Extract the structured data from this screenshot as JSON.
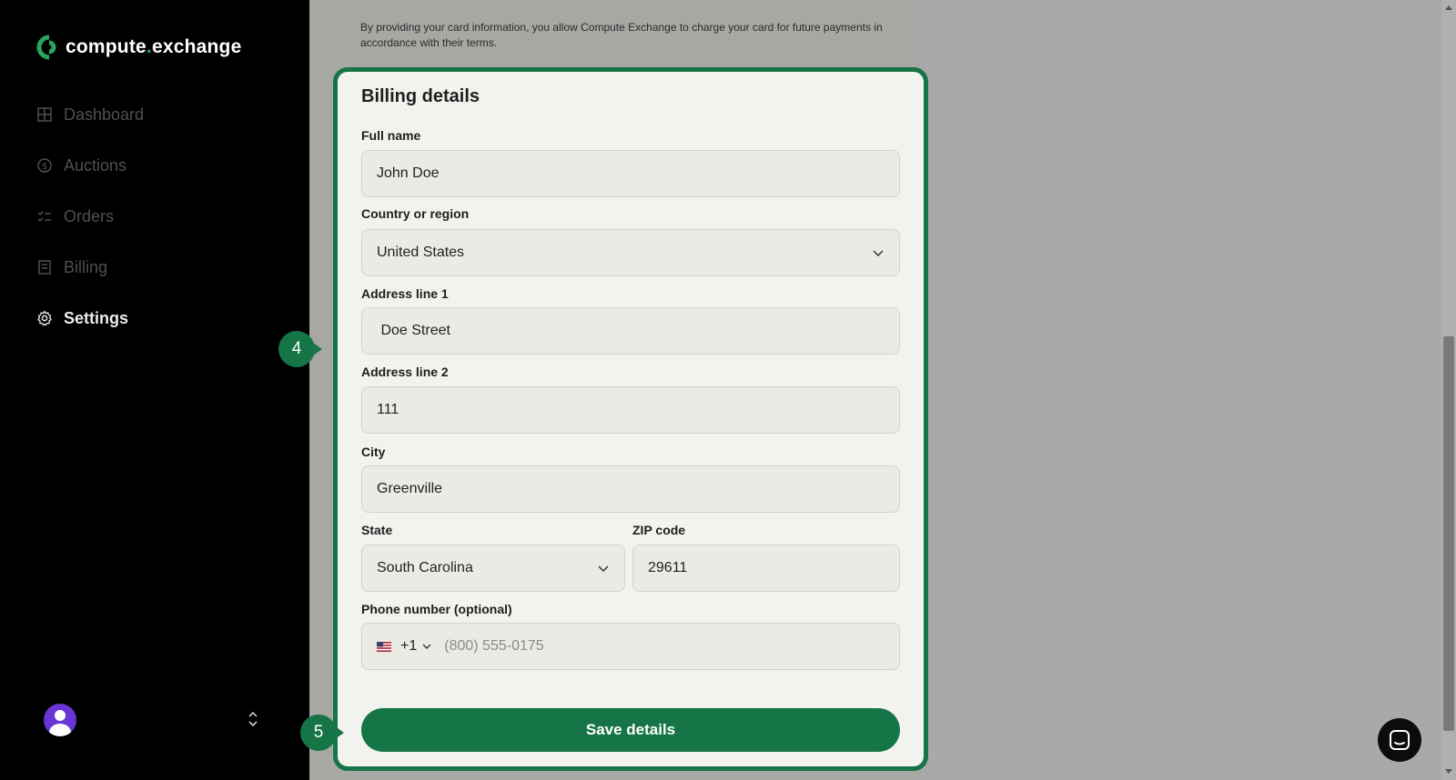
{
  "brand": {
    "name_part1": "compute",
    "dot": ".",
    "name_part2": "exchange"
  },
  "sidebar": {
    "items": [
      {
        "label": "Dashboard",
        "icon": "grid-icon"
      },
      {
        "label": "Auctions",
        "icon": "dollar-circle-icon"
      },
      {
        "label": "Orders",
        "icon": "checklist-icon"
      },
      {
        "label": "Billing",
        "icon": "document-icon"
      },
      {
        "label": "Settings",
        "icon": "gear-icon",
        "active": true
      }
    ]
  },
  "consent_text": "By providing your card information, you allow Compute Exchange to charge your card for future payments in accordance with their terms.",
  "billing": {
    "title": "Billing details",
    "full_name_label": "Full name",
    "full_name_value": "John Doe",
    "country_label": "Country or region",
    "country_value": "United States",
    "address1_label": "Address line 1",
    "address1_value": " Doe Street",
    "address2_label": "Address line 2",
    "address2_value": "111",
    "city_label": "City",
    "city_value": "Greenville",
    "state_label": "State",
    "state_value": "South Carolina",
    "zip_label": "ZIP code",
    "zip_value": "29611",
    "phone_label": "Phone number (optional)",
    "phone_code": "+1",
    "phone_placeholder": "(800) 555-0175",
    "save_label": "Save details"
  },
  "steps": {
    "step4": "4",
    "step5": "5"
  },
  "colors": {
    "accent": "#157547",
    "sidebar_bg": "#000000",
    "card_bg": "#f2f2ee"
  }
}
